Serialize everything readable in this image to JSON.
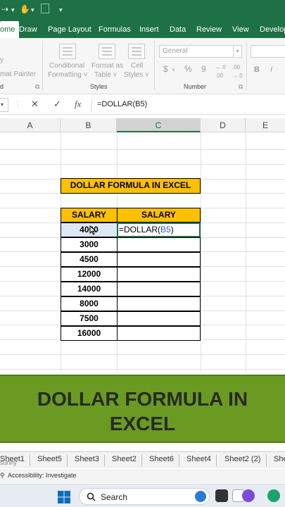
{
  "ribbon": {
    "tabs": [
      "ome",
      "Draw",
      "Page Layout",
      "Formulas",
      "Insert",
      "Data",
      "Review",
      "View",
      "Develop"
    ],
    "clipboard": {
      "line1": "y",
      "line2": "mat Painter",
      "group_label": "d"
    },
    "styles": {
      "conditional": [
        "Conditional",
        "Formatting ˅"
      ],
      "format_table": [
        "Format as",
        "Table ˅"
      ],
      "cell_styles": [
        "Cell",
        "Styles ˅"
      ],
      "group_label": "Styles"
    },
    "number": {
      "format_value": "General",
      "symbols": [
        "$",
        "%",
        "9"
      ],
      "group_label": "Number"
    },
    "font_buttons": [
      "B",
      "I"
    ]
  },
  "formula_bar": {
    "cancel": "✕",
    "enter": "✓",
    "fx": "fx",
    "formula": "=DOLLAR(B5)"
  },
  "columns": [
    "A",
    "B",
    "C",
    "D",
    "E"
  ],
  "sheet": {
    "title": "DOLLAR FORMULA IN EXCEL",
    "headers": [
      "SALARY",
      "SALARY"
    ],
    "values": [
      "4000",
      "3000",
      "4500",
      "12000",
      "14000",
      "8000",
      "7500",
      "16000"
    ],
    "editing": {
      "prefix": "=DOLLAR(",
      "ref": "B5",
      "suffix": ")"
    }
  },
  "banner": {
    "line1": "DOLLAR FORMULA IN",
    "line2": "EXCEL"
  },
  "sheet_tabs": [
    "Sheet1",
    "Sheet5",
    "Sheet3",
    "Sheet2",
    "Sheet6",
    "Sheet4",
    "Sheet2 (2)",
    "She"
  ],
  "status": {
    "left": "sunny",
    "accessibility": "Accessibility: Investigate"
  },
  "taskbar": {
    "search_label": "Search"
  },
  "colors": {
    "excel_green": "#1e7145",
    "header_yellow": "#ffc000",
    "banner_green": "#6b9a22"
  }
}
